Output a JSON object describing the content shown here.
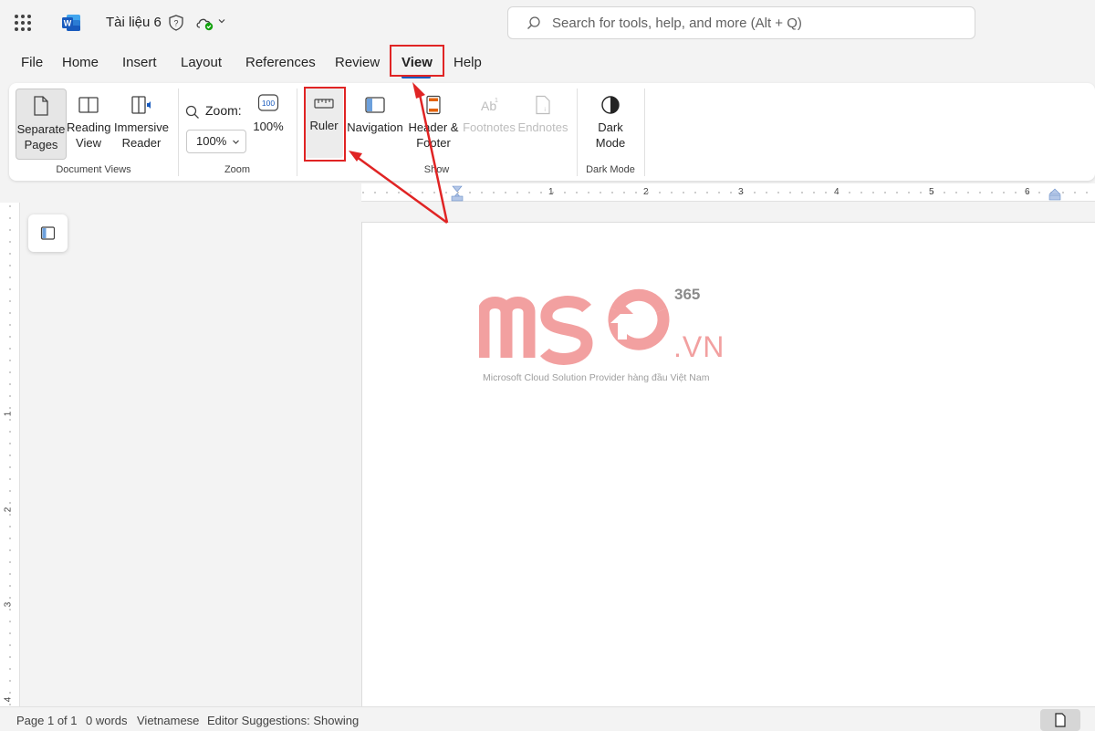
{
  "titlebar": {
    "doc_title": "Tài liệu 6",
    "search_placeholder": "Search for tools, help, and more (Alt + Q)",
    "icons": [
      "app-launcher-icon",
      "word-logo-icon",
      "sensitivity-shield-icon",
      "cloud-saved-icon",
      "chevron-down-icon",
      "search-icon"
    ]
  },
  "tabs": [
    {
      "label": "File"
    },
    {
      "label": "Home"
    },
    {
      "label": "Insert"
    },
    {
      "label": "Layout"
    },
    {
      "label": "References"
    },
    {
      "label": "Review"
    },
    {
      "label": "View",
      "active": true
    },
    {
      "label": "Help"
    }
  ],
  "ribbon": {
    "document_views": {
      "label": "Document Views",
      "separate_pages": "Separate\nPages",
      "separate_pages_l1": "Separate",
      "separate_pages_l2": "Pages",
      "reading_l1": "Reading",
      "reading_l2": "View",
      "immersive_l1": "Immersive",
      "immersive_l2": "Reader"
    },
    "zoom": {
      "label": "Zoom",
      "zoom_label": "Zoom:",
      "zoom_value": "100%",
      "hundred_label": "100%"
    },
    "show": {
      "label": "Show",
      "ruler": "Ruler",
      "navigation": "Navigation",
      "header_footer_l1": "Header &",
      "header_footer_l2": "Footer",
      "footnotes": "Footnotes",
      "endnotes": "Endnotes"
    },
    "dark_mode": {
      "label": "Dark Mode",
      "btn_l1": "Dark",
      "btn_l2": "Mode"
    }
  },
  "ruler": {
    "horizontal": [
      "1",
      "2",
      "3",
      "4",
      "5",
      "6"
    ],
    "vertical": [
      "1",
      "2",
      "3",
      "4"
    ]
  },
  "document": {
    "watermark_365": "365",
    "watermark_vn": ".VN",
    "watermark_tagline": "Microsoft Cloud Solution Provider hàng đầu Việt Nam"
  },
  "statusbar": {
    "page": "Page 1 of 1",
    "words": "0 words",
    "language": "Vietnamese",
    "editor": "Editor Suggestions: Showing"
  },
  "colors": {
    "accent": "#185abd",
    "highlight_red": "#e02424",
    "watermark_pink": "#f2a0a0"
  }
}
